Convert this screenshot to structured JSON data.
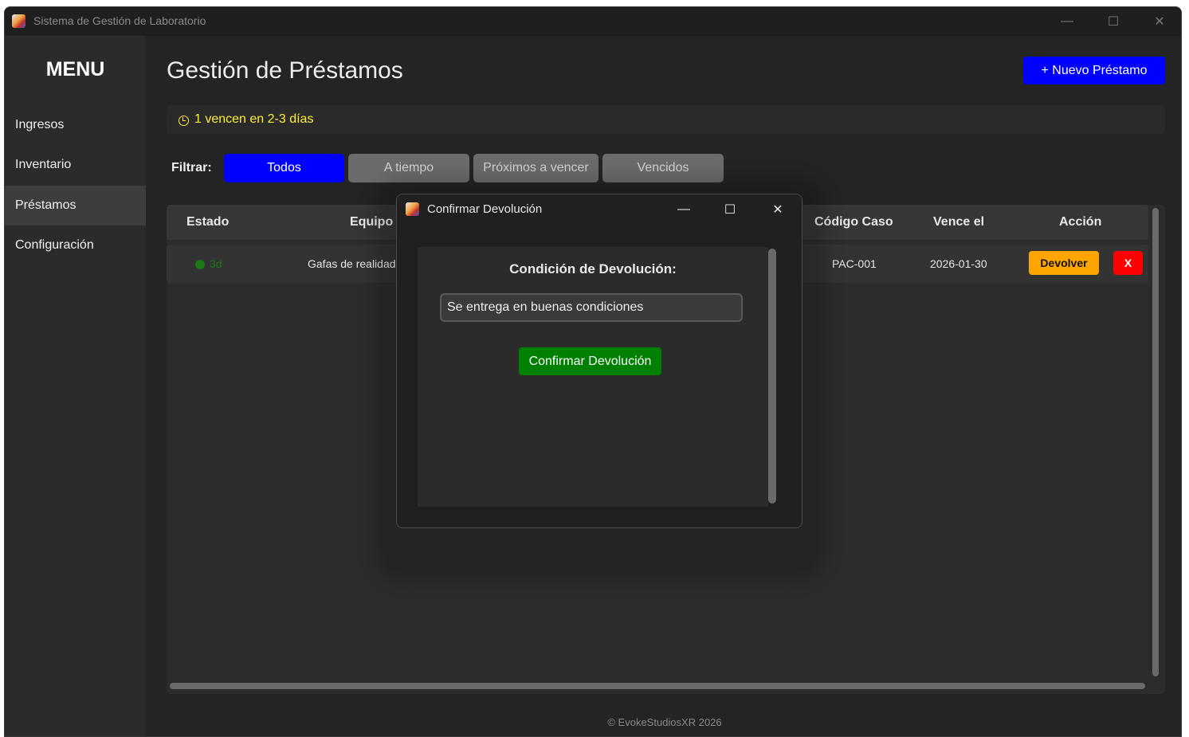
{
  "window": {
    "title": "Sistema de Gestión de Laboratorio",
    "minimize": "—",
    "maximize": "☐",
    "close": "✕"
  },
  "sidebar": {
    "title": "MENU",
    "items": [
      {
        "label": "Ingresos"
      },
      {
        "label": "Inventario"
      },
      {
        "label": "Préstamos"
      },
      {
        "label": "Configuración"
      }
    ],
    "active": "Préstamos"
  },
  "header": {
    "title": "Gestión de Préstamos",
    "new_button": "+ Nuevo Préstamo"
  },
  "alert": {
    "text": "1 vencen en 2-3 días",
    "icon": "clock-icon",
    "color": "#ffee33"
  },
  "filter": {
    "label": "Filtrar:",
    "options": [
      "Todos",
      "A tiempo",
      "Próximos a vencer",
      "Vencidos"
    ],
    "selected": "Todos"
  },
  "table": {
    "columns": [
      "Estado",
      "Equipo",
      "Código Caso",
      "Vence el",
      "Acción"
    ],
    "rows": [
      {
        "status": "3d",
        "status_color": "#1a7a1a",
        "equipo": "Gafas de realidad",
        "codigo": "PAC-001",
        "vence": "2026-01-30",
        "action_return": "Devolver",
        "action_delete": "X"
      }
    ]
  },
  "footer": "© EvokeStudiosXR 2026",
  "dialog": {
    "title": "Confirmar Devolución",
    "minimize": "—",
    "maximize": "☐",
    "close": "✕",
    "label": "Condición de Devolución:",
    "input_value": "Se entrega en buenas condiciones",
    "confirm_button": "Confirmar Devolución"
  },
  "colors": {
    "accent_blue": "#0000ff",
    "confirm_green": "#008000",
    "return_orange": "#ffa500",
    "delete_red": "#ff0000"
  }
}
